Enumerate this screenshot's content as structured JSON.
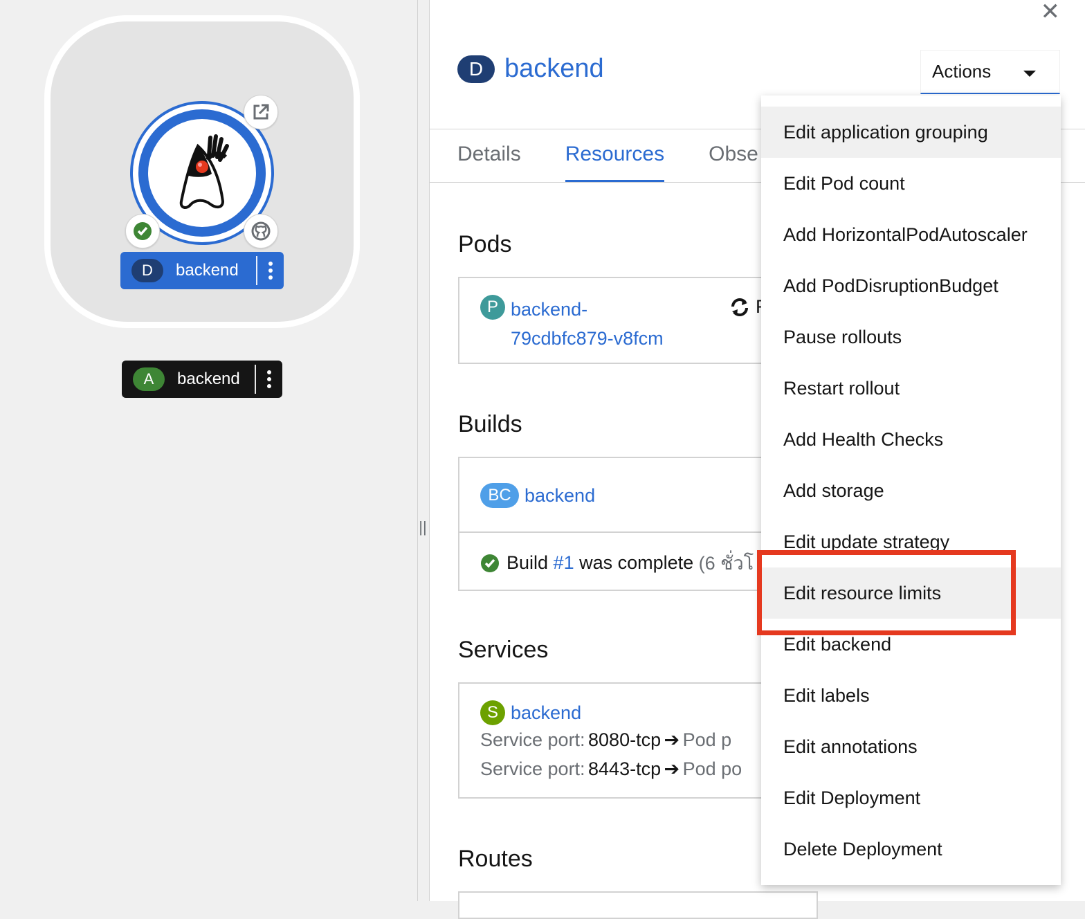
{
  "topology": {
    "group_node": {
      "deployment_label": "backend",
      "deployment_badge": "D",
      "deployment_badge_color": "#1f3e73",
      "label_color": "#2b6bd1",
      "decorators": [
        "external-link-icon",
        "check-circle-icon",
        "github-icon"
      ],
      "runtime_icon": "java-duke-icon"
    },
    "application_node": {
      "label": "backend",
      "badge": "A",
      "badge_color": "#3e8635",
      "label_bg": "#151515"
    }
  },
  "sidepanel": {
    "close_icon": "close-icon",
    "resource_badge": "D",
    "title": "backend",
    "actions_label": "Actions",
    "tabs": [
      {
        "label": "Details",
        "active": false
      },
      {
        "label": "Resources",
        "active": true
      },
      {
        "label": "Obse",
        "active": false
      }
    ],
    "pods": {
      "heading": "Pods",
      "badge": "P",
      "badge_color": "#2b9af3",
      "name_line1": "backend-",
      "name_line2": "79cdbfc879-v8fcm",
      "status_icon": "sync-icon",
      "status_text_partial": "R"
    },
    "builds": {
      "heading": "Builds",
      "badge": "BC",
      "badge_color": "#4f9fe8",
      "name": "backend",
      "status_icon": "check-circle-icon",
      "status_prefix": "Build ",
      "build_link": "#1",
      "status_suffix": " was complete ",
      "status_time": "(6 ชั่วโ"
    },
    "services": {
      "heading": "Services",
      "badge": "S",
      "badge_color": "#6ca100",
      "name": "backend",
      "ports": [
        {
          "label": "Service port:",
          "value": "8080-tcp",
          "arrow": "➔",
          "target": "Pod p"
        },
        {
          "label": "Service port:",
          "value": "8443-tcp",
          "arrow": "➔",
          "target": "Pod po"
        }
      ]
    },
    "routes": {
      "heading": "Routes"
    }
  },
  "actions_menu": {
    "items": [
      "Edit application grouping",
      "Edit Pod count",
      "Add HorizontalPodAutoscaler",
      "Add PodDisruptionBudget",
      "Pause rollouts",
      "Restart rollout",
      "Add Health Checks",
      "Add storage",
      "Edit update strategy",
      "Edit resource limits",
      "Edit backend",
      "Edit labels",
      "Edit annotations",
      "Edit Deployment",
      "Delete Deployment"
    ],
    "highlighted_item": "Edit resource limits",
    "highlight_color": "#e5391f"
  }
}
